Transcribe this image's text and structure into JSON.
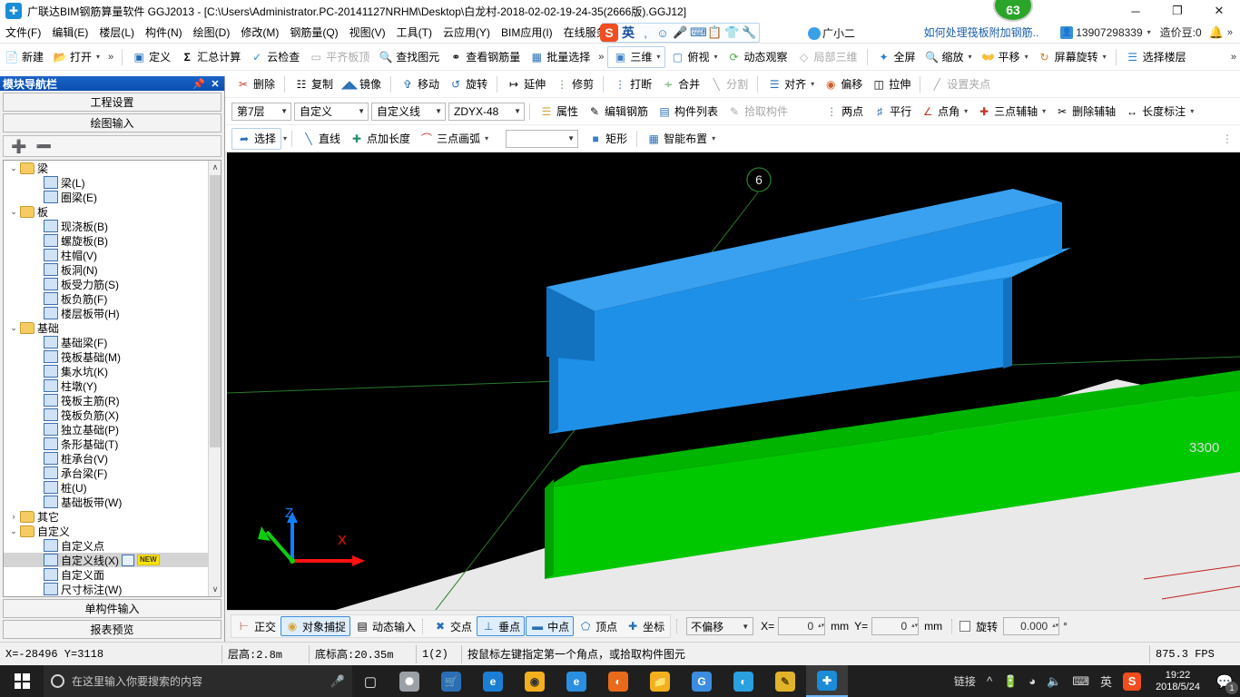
{
  "window": {
    "app_icon": "grid-plus-icon",
    "title": "广联达BIM钢筋算量软件 GGJ2013 - [C:\\Users\\Administrator.PC-20141127NRHM\\Desktop\\白龙村-2018-02-02-19-24-35(2666版).GGJ12]",
    "minimize": "─",
    "maximize": "❐",
    "close": "✕",
    "perf_badge": "63"
  },
  "menubar": {
    "items": [
      "文件(F)",
      "编辑(E)",
      "楼层(L)",
      "构件(N)",
      "绘图(D)",
      "修改(M)",
      "钢筋量(Q)",
      "视图(V)",
      "工具(T)",
      "云应用(Y)",
      "BIM应用(I)",
      "在线服务(S)"
    ]
  },
  "ime": {
    "logo": "S",
    "mode": "英",
    "icons": [
      "comma-icon",
      "smiley-icon",
      "mic-icon",
      "keyboard-icon",
      "clipboard-icon",
      "skin-icon",
      "wrench-icon"
    ],
    "buddy_label": "广小二"
  },
  "titlebar_right": {
    "promo": "如何处理筏板附加钢筋..",
    "account": "13907298339",
    "account_caret": "▾",
    "coin": "造价豆:0",
    "bell": "🔔",
    "overflow": "»"
  },
  "toolbar_row1": {
    "buttons": [
      {
        "label": "新建",
        "icon": "new-file-icon"
      },
      {
        "label": "打开",
        "icon": "open-folder-icon",
        "caret": "▾"
      }
    ],
    "overflow": "»",
    "group2": [
      {
        "label": "定义",
        "icon": "define-icon"
      },
      {
        "label": "汇总计算",
        "icon": "sigma-icon"
      },
      {
        "label": "云检查",
        "icon": "cloud-check-icon"
      },
      {
        "label": "平齐板顶",
        "icon": "align-slab-icon",
        "disabled": true
      },
      {
        "label": "查找图元",
        "icon": "binoculars-icon"
      },
      {
        "label": "查看钢筋量",
        "icon": "view-rebar-icon"
      },
      {
        "label": "批量选择",
        "icon": "batch-select-icon"
      }
    ],
    "group3_overflow": "»",
    "group3": [
      {
        "label": "三维",
        "icon": "cube-icon",
        "caret": "▾",
        "selected": true
      },
      {
        "label": "俯视",
        "icon": "topview-icon",
        "caret": "▾"
      },
      {
        "label": "动态观察",
        "icon": "orbit-icon"
      },
      {
        "label": "局部三维",
        "icon": "partial3d-icon",
        "disabled": true
      },
      {
        "label": "全屏",
        "icon": "fullscreen-icon"
      },
      {
        "label": "缩放",
        "icon": "zoom-icon",
        "caret": "▾"
      },
      {
        "label": "平移",
        "icon": "pan-icon",
        "caret": "▾"
      },
      {
        "label": "屏幕旋转",
        "icon": "screen-rotate-icon",
        "caret": "▾"
      },
      {
        "label": "选择楼层",
        "icon": "select-floor-icon"
      }
    ],
    "far_overflow": "»"
  },
  "toolbar_row2": {
    "buttons": [
      {
        "label": "删除",
        "icon": "delete-icon"
      },
      {
        "label": "复制",
        "icon": "copy-icon"
      },
      {
        "label": "镜像",
        "icon": "mirror-icon"
      },
      {
        "label": "移动",
        "icon": "move-icon"
      },
      {
        "label": "旋转",
        "icon": "rotate-icon"
      },
      {
        "label": "延伸",
        "icon": "extend-icon"
      },
      {
        "label": "修剪",
        "icon": "trim-icon"
      },
      {
        "label": "打断",
        "icon": "break-icon"
      },
      {
        "label": "合并",
        "icon": "merge-icon"
      },
      {
        "label": "分割",
        "icon": "split-icon",
        "disabled": true
      },
      {
        "label": "对齐",
        "icon": "align-icon",
        "caret": "▾"
      },
      {
        "label": "偏移",
        "icon": "offset-icon"
      },
      {
        "label": "拉伸",
        "icon": "stretch-icon"
      },
      {
        "label": "设置夹点",
        "icon": "set-grip-icon",
        "disabled": true
      }
    ]
  },
  "toolbar_row3": {
    "floor_combo": "第7层",
    "category_combo": "自定义",
    "type_combo": "自定义线",
    "member_combo": "ZDYX-48",
    "buttons": [
      {
        "label": "属性",
        "icon": "properties-icon"
      },
      {
        "label": "编辑钢筋",
        "icon": "edit-rebar-icon"
      },
      {
        "label": "构件列表",
        "icon": "member-list-icon"
      },
      {
        "label": "拾取构件",
        "icon": "pick-member-icon",
        "disabled": true
      }
    ],
    "axis_buttons": [
      {
        "label": "两点",
        "icon": "two-point-icon"
      },
      {
        "label": "平行",
        "icon": "parallel-icon"
      },
      {
        "label": "点角",
        "icon": "point-angle-icon",
        "caret": "▾"
      },
      {
        "label": "三点辅轴",
        "icon": "three-point-axis-icon",
        "caret": "▾"
      },
      {
        "label": "删除辅轴",
        "icon": "delete-axis-icon"
      },
      {
        "label": "长度标注",
        "icon": "length-dim-icon",
        "caret": "▾"
      }
    ]
  },
  "toolbar_row4": {
    "select_btn": {
      "label": "选择",
      "icon": "arrow-select-icon",
      "caret": "▾",
      "selected": true
    },
    "buttons": [
      {
        "label": "直线",
        "icon": "line-icon"
      },
      {
        "label": "点加长度",
        "icon": "point-length-icon"
      },
      {
        "label": "三点画弧",
        "icon": "three-point-arc-icon",
        "caret": "▾"
      }
    ],
    "blank_combo": "",
    "buttons2": [
      {
        "label": "矩形",
        "icon": "rectangle-icon"
      },
      {
        "label": "智能布置",
        "icon": "smart-layout-icon",
        "caret": "▾"
      }
    ],
    "grip": "⋮"
  },
  "dock": {
    "title": "模块导航栏",
    "pin_icon": "pin-icon",
    "close_icon": "close-icon",
    "buttons": [
      "工程设置",
      "绘图输入"
    ],
    "expand_all_icon": "expand-all-icon",
    "collapse_all_icon": "collapse-all-icon",
    "bottom_buttons": [
      "单构件输入",
      "报表预览"
    ],
    "tree": [
      {
        "level": 1,
        "label": "梁",
        "type": "folder",
        "expander": "⌄"
      },
      {
        "level": 2,
        "label": "梁(L)",
        "type": "item"
      },
      {
        "level": 2,
        "label": "圈梁(E)",
        "type": "item"
      },
      {
        "level": 1,
        "label": "板",
        "type": "folder",
        "expander": "⌄"
      },
      {
        "level": 2,
        "label": "现浇板(B)",
        "type": "item"
      },
      {
        "level": 2,
        "label": "螺旋板(B)",
        "type": "item"
      },
      {
        "level": 2,
        "label": "柱帽(V)",
        "type": "item"
      },
      {
        "level": 2,
        "label": "板洞(N)",
        "type": "item"
      },
      {
        "level": 2,
        "label": "板受力筋(S)",
        "type": "item"
      },
      {
        "level": 2,
        "label": "板负筋(F)",
        "type": "item"
      },
      {
        "level": 2,
        "label": "楼层板带(H)",
        "type": "item"
      },
      {
        "level": 1,
        "label": "基础",
        "type": "folder",
        "expander": "⌄"
      },
      {
        "level": 2,
        "label": "基础梁(F)",
        "type": "item"
      },
      {
        "level": 2,
        "label": "筏板基础(M)",
        "type": "item"
      },
      {
        "level": 2,
        "label": "集水坑(K)",
        "type": "item"
      },
      {
        "level": 2,
        "label": "柱墩(Y)",
        "type": "item"
      },
      {
        "level": 2,
        "label": "筏板主筋(R)",
        "type": "item"
      },
      {
        "level": 2,
        "label": "筏板负筋(X)",
        "type": "item"
      },
      {
        "level": 2,
        "label": "独立基础(P)",
        "type": "item"
      },
      {
        "level": 2,
        "label": "条形基础(T)",
        "type": "item"
      },
      {
        "level": 2,
        "label": "桩承台(V)",
        "type": "item"
      },
      {
        "level": 2,
        "label": "承台梁(F)",
        "type": "item"
      },
      {
        "level": 2,
        "label": "桩(U)",
        "type": "item"
      },
      {
        "level": 2,
        "label": "基础板带(W)",
        "type": "item"
      },
      {
        "level": 1,
        "label": "其它",
        "type": "folder",
        "expander": "›"
      },
      {
        "level": 1,
        "label": "自定义",
        "type": "folder",
        "expander": "⌄"
      },
      {
        "level": 2,
        "label": "自定义点",
        "type": "item"
      },
      {
        "level": 2,
        "label": "自定义线(X)",
        "type": "item",
        "selected": true,
        "badge": "NEW",
        "extra_icon": "mini-grid-icon"
      },
      {
        "level": 2,
        "label": "自定义面",
        "type": "item"
      },
      {
        "level": 2,
        "label": "尺寸标注(W)",
        "type": "item"
      }
    ],
    "scroll_up": "∧",
    "scroll_down": "∨"
  },
  "viewport": {
    "axis_number_label": "6",
    "dimension_label": "3300",
    "axis_z": "Z",
    "axis_x": "X",
    "colors": {
      "background": "#000000",
      "selected_member": "#1080e0",
      "member": "#00c800",
      "slab": "#e8e8e8",
      "axis_line": "#2a7a2a",
      "rebar_line": "#c02020"
    }
  },
  "snapbar": {
    "group1": [
      {
        "label": "正交",
        "icon": "ortho-icon",
        "on": false
      },
      {
        "label": "对象捕捉",
        "icon": "object-snap-icon",
        "on": true
      },
      {
        "label": "动态输入",
        "icon": "dynamic-input-icon",
        "on": false
      }
    ],
    "group2": [
      {
        "label": "交点",
        "icon": "intersection-icon",
        "on": false
      },
      {
        "label": "垂点",
        "icon": "perpendicular-icon",
        "on": true
      },
      {
        "label": "中点",
        "icon": "midpoint-icon",
        "on": true
      },
      {
        "label": "顶点",
        "icon": "vertex-icon",
        "on": false
      },
      {
        "label": "坐标",
        "icon": "coordinate-icon",
        "on": false
      }
    ],
    "offset_mode": "不偏移",
    "offset_caret": "▾",
    "x_label": "X=",
    "x_value": "0",
    "x_unit": "mm",
    "y_label": "Y=",
    "y_value": "0",
    "y_unit": "mm",
    "rotate_label": "旋转",
    "rotate_value": "0.000",
    "rotate_unit": "°"
  },
  "statusbar": {
    "coords": "X=-28496  Y=3118",
    "floor_height": "层高:2.8m",
    "base_elevation": "底标高:20.35m",
    "count": "1(2)",
    "message": "按鼠标左键指定第一个角点，或拾取构件图元",
    "fps": "875.3 FPS"
  },
  "taskbar": {
    "start_icon": "windows-logo-icon",
    "search_placeholder": "在这里输入你要搜索的内容",
    "mic_icon": "mic-icon",
    "taskview_icon": "task-view-icon",
    "apps": [
      {
        "name": "cortana-icon",
        "glyph": "○",
        "color": "#7a7a7a"
      },
      {
        "name": "edge-legacy-icon",
        "glyph": "e",
        "color": "#1a7fd4"
      },
      {
        "name": "chrome-variant-icon",
        "glyph": "◎",
        "color": "#f2b01e"
      },
      {
        "name": "edge-icon",
        "glyph": "e",
        "color": "#2a8fe0"
      },
      {
        "name": "firefox-icon",
        "glyph": "◑",
        "color": "#e86a1a"
      },
      {
        "name": "file-explorer-icon",
        "glyph": "▤",
        "color": "#f2b01e"
      },
      {
        "name": "google-icon",
        "glyph": "G",
        "color": "#3c8de0"
      },
      {
        "name": "browser-icon",
        "glyph": "◐",
        "color": "#2aa0e0"
      },
      {
        "name": "notes-icon",
        "glyph": "✎",
        "color": "#e0b32a"
      },
      {
        "name": "ggj-app-icon",
        "glyph": "➕",
        "color": "#1a8cd8",
        "active": true
      }
    ],
    "tray_text": "链接",
    "tray_icons": [
      "chevron-up-icon",
      "battery-icon",
      "wifi-icon",
      "volume-icon",
      "keyboard-icon"
    ],
    "ime_mode": "英",
    "sogou_icon": "S",
    "time": "19:22",
    "date": "2018/5/24",
    "notification_icon": "notification-icon",
    "notification_count": "1"
  }
}
